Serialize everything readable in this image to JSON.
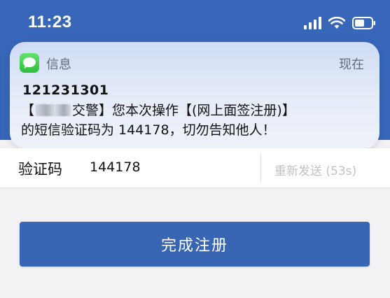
{
  "status_bar": {
    "time": "11:23"
  },
  "notification": {
    "app_name": "信息",
    "time": "现在",
    "app_icon": "messages-bubble-icon",
    "sender": "121231301",
    "body_line1_prefix": "【",
    "body_line1_suffix": "交警】您本次操作【(网上面签注册)】",
    "body_line2": "的短信验证码为 144178，切勿告知他人！"
  },
  "verify": {
    "label": "验证码",
    "value": "144178",
    "resend_label": "重新发送 (53s)"
  },
  "complete_button": {
    "label": "完成注册"
  },
  "colors": {
    "header_blue": "#3866b8",
    "button_blue": "#3866b4",
    "messages_green": "#2fbf3c",
    "resend_gray": "#c2c2c6"
  }
}
